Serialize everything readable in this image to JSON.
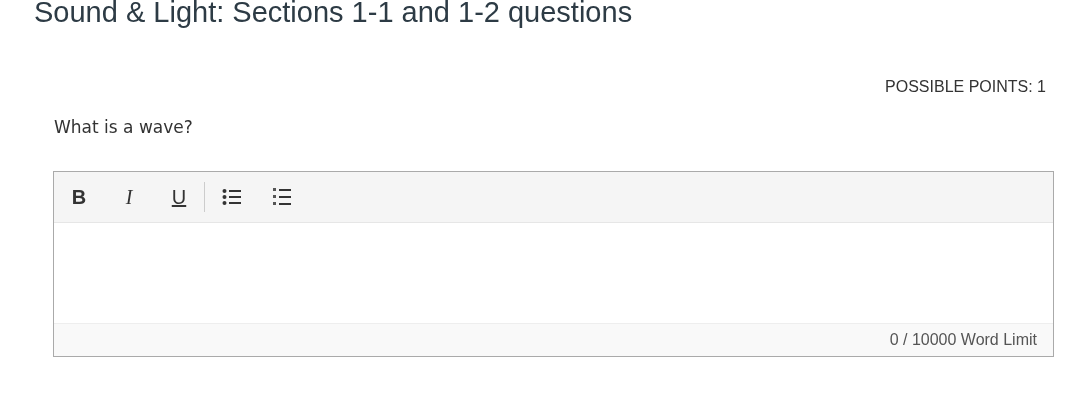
{
  "title": "Sound & Light: Sections 1-1 and 1-2 questions",
  "possible_points": "POSSIBLE POINTS: 1",
  "question": "What is a wave?",
  "toolbar": [
    {
      "kind": "bold",
      "label": "B"
    },
    {
      "kind": "italic",
      "label": "I"
    },
    {
      "kind": "underline",
      "label": "U"
    },
    {
      "kind": "separator"
    },
    {
      "kind": "bullet-list"
    },
    {
      "kind": "numbered-list"
    }
  ],
  "word_count": "0 / 10000 Word Limit"
}
